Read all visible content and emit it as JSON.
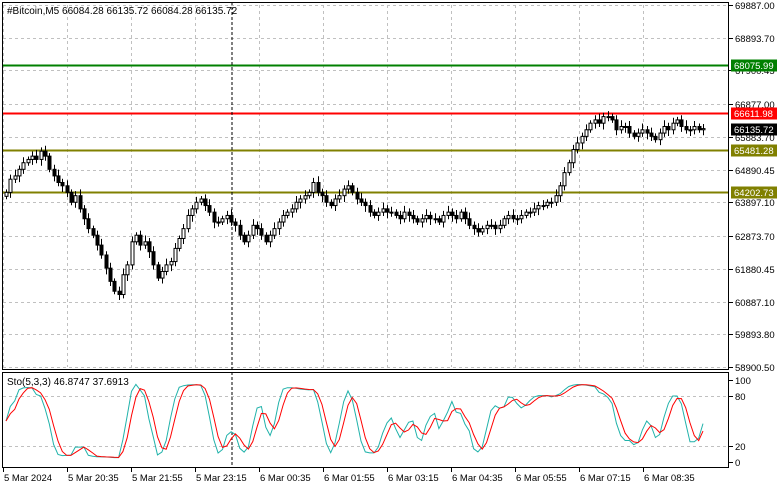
{
  "header": {
    "symbol_line": "#Bitcoin,M5  66084.28 66135.72 66084.28 66135.72"
  },
  "indicator": {
    "label": "Sto(5,3,3) 46.8747 37.6913",
    "axis_ticks": [
      "100",
      "80",
      "20",
      "0"
    ]
  },
  "colors": {
    "candle": "#000000",
    "resistance": "#ff0000",
    "upper_target": "#008000",
    "support": "#808000",
    "stoch_main": "#20b2aa",
    "stoch_signal": "#ff0000",
    "grid": "#c0c0c0",
    "current_price_bg": "#000000"
  },
  "chart_data": [
    {
      "type": "candlestick",
      "title": "#Bitcoin,M5",
      "ylim": [
        58900.5,
        69887.0
      ],
      "y_ticks": [
        "69887.00",
        "68893.70",
        "67900.45",
        "66877.00",
        "65883.70",
        "64890.45",
        "63897.10",
        "62873.70",
        "61880.45",
        "60887.10",
        "59893.80",
        "58900.50"
      ],
      "x_ticks": [
        "5 Mar 2024",
        "5 Mar 20:35",
        "5 Mar 21:55",
        "5 Mar 23:15",
        "6 Mar 00:35",
        "6 Mar 01:55",
        "6 Mar 03:15",
        "6 Mar 04:35",
        "6 Mar 05:55",
        "6 Mar 07:15",
        "6 Mar 08:35"
      ],
      "levels": [
        {
          "name": "upper_target",
          "value": 68075.99,
          "label": "68075.99",
          "color": "#008000"
        },
        {
          "name": "resistance",
          "value": 66611.98,
          "label": "66611.98",
          "color": "#ff0000"
        },
        {
          "name": "support_1",
          "value": 65481.28,
          "label": "65481.28",
          "color": "#808000"
        },
        {
          "name": "support_2",
          "value": 64202.73,
          "label": "64202.73",
          "color": "#808000"
        }
      ],
      "current_price": {
        "value": 66135.72,
        "label": "66135.72"
      },
      "closes": [
        64200,
        64600,
        64700,
        64900,
        65100,
        65200,
        65300,
        65200,
        65450,
        65300,
        64900,
        64700,
        64500,
        64400,
        64200,
        63900,
        64100,
        63700,
        63400,
        63100,
        62900,
        62600,
        62300,
        61900,
        61500,
        61200,
        61100,
        61700,
        62000,
        62700,
        62900,
        62600,
        62700,
        62400,
        62000,
        61600,
        61800,
        62000,
        62100,
        62500,
        62800,
        63100,
        63500,
        63700,
        63900,
        64000,
        63800,
        63600,
        63300,
        63300,
        63400,
        63500,
        63300,
        63200,
        62900,
        62700,
        62900,
        63200,
        63100,
        62900,
        62700,
        62900,
        63100,
        63300,
        63500,
        63600,
        63700,
        63900,
        64000,
        64100,
        64200,
        64500,
        64200,
        64100,
        63900,
        63800,
        64000,
        64100,
        64300,
        64400,
        64200,
        64000,
        63900,
        63800,
        63600,
        63500,
        63600,
        63700,
        63600,
        63600,
        63500,
        63400,
        63600,
        63500,
        63400,
        63300,
        63400,
        63500,
        63400,
        63400,
        63300,
        63500,
        63600,
        63500,
        63400,
        63600,
        63400,
        63200,
        63100,
        63000,
        63100,
        63200,
        63200,
        63100,
        63200,
        63400,
        63500,
        63400,
        63400,
        63500,
        63600,
        63600,
        63700,
        63800,
        63800,
        63900,
        63900,
        64100,
        64400,
        64800,
        65100,
        65500,
        65700,
        65900,
        66100,
        66300,
        66400,
        66300,
        66500,
        66500,
        66400,
        66100,
        66200,
        66200,
        66000,
        65900,
        66000,
        66100,
        66000,
        65900,
        65800,
        66000,
        66200,
        66100,
        66300,
        66400,
        66200,
        66100,
        66100,
        66200,
        66100,
        66135.72
      ],
      "stochastic": {
        "name": "Sto(5,3,3)",
        "ylim": [
          0,
          100
        ],
        "levels": [
          80,
          20
        ],
        "main_last": 46.8747,
        "signal_last": 37.6913
      }
    }
  ]
}
